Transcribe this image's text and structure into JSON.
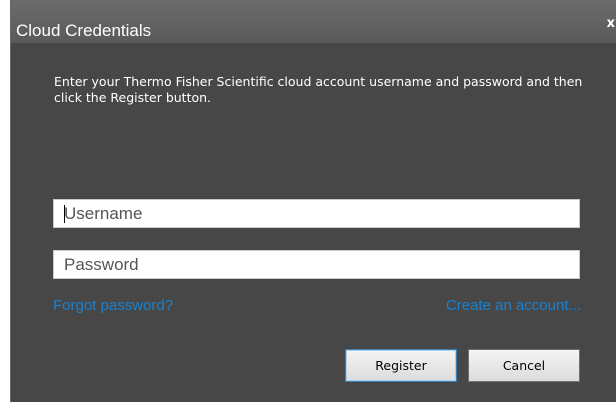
{
  "window": {
    "title": "Cloud Credentials",
    "close_label": "x"
  },
  "instructions": "Enter your Thermo Fisher Scientific cloud account username and password and then click the Register button.",
  "form": {
    "username_placeholder": "Username",
    "password_placeholder": "Password"
  },
  "links": {
    "forgot": "Forgot password?",
    "create": "Create an account..."
  },
  "buttons": {
    "register": "Register",
    "cancel": "Cancel"
  },
  "colors": {
    "background": "#474747",
    "titlebar": "#5f5f5f",
    "link": "#1a82d1",
    "default_button_border": "#3c7fb1"
  }
}
